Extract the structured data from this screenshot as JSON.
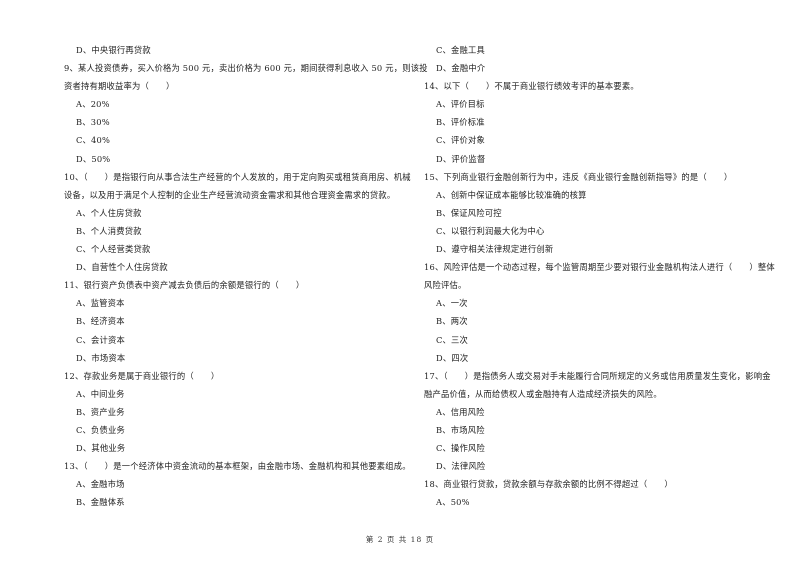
{
  "left_column": [
    {
      "type": "opt",
      "text": "D、中央银行再贷款"
    },
    {
      "type": "q",
      "text": "9、某人投资债券，买入价格为 500 元，卖出价格为 600 元，期间获得利息收入 50 元，则该投"
    },
    {
      "type": "q",
      "text": "资者持有期收益率为（　　）"
    },
    {
      "type": "opt",
      "text": "A、20%"
    },
    {
      "type": "opt",
      "text": "B、30%"
    },
    {
      "type": "opt",
      "text": "C、40%"
    },
    {
      "type": "opt",
      "text": "D、50%"
    },
    {
      "type": "q",
      "text": "10、（　　）是指银行向从事合法生产经营的个人发放的，用于定向购买或租赁商用房、机械"
    },
    {
      "type": "q",
      "text": "设备，以及用于满足个人控制的企业生产经营流动资金需求和其他合理资金需求的贷款。"
    },
    {
      "type": "opt",
      "text": "A、个人住房贷款"
    },
    {
      "type": "opt",
      "text": "B、个人消费贷款"
    },
    {
      "type": "opt",
      "text": "C、个人经营类贷款"
    },
    {
      "type": "opt",
      "text": "D、自营性个人住房贷款"
    },
    {
      "type": "q",
      "text": "11、银行资产负债表中资产减去负债后的余额是银行的（　　）"
    },
    {
      "type": "opt",
      "text": "A、监管资本"
    },
    {
      "type": "opt",
      "text": "B、经济资本"
    },
    {
      "type": "opt",
      "text": "C、会计资本"
    },
    {
      "type": "opt",
      "text": "D、市场资本"
    },
    {
      "type": "q",
      "text": "12、存款业务是属于商业银行的（　　）"
    },
    {
      "type": "opt",
      "text": "A、中间业务"
    },
    {
      "type": "opt",
      "text": "B、资产业务"
    },
    {
      "type": "opt",
      "text": "C、负债业务"
    },
    {
      "type": "opt",
      "text": "D、其他业务"
    },
    {
      "type": "q",
      "text": "13、（　　）是一个经济体中资金流动的基本框架，由金融市场、金融机构和其他要素组成。"
    },
    {
      "type": "opt",
      "text": "A、金融市场"
    },
    {
      "type": "opt",
      "text": "B、金融体系"
    }
  ],
  "right_column": [
    {
      "type": "opt",
      "text": "C、金融工具"
    },
    {
      "type": "opt",
      "text": "D、金融中介"
    },
    {
      "type": "q",
      "text": "14、以下（　　）不属于商业银行绩效考评的基本要素。"
    },
    {
      "type": "opt",
      "text": "A、评价目标"
    },
    {
      "type": "opt",
      "text": "B、评价标准"
    },
    {
      "type": "opt",
      "text": "C、评价对象"
    },
    {
      "type": "opt",
      "text": "D、评价监督"
    },
    {
      "type": "q",
      "text": "15、下列商业银行金融创新行为中，违反《商业银行金融创新指导》的是（　　）"
    },
    {
      "type": "opt",
      "text": "A、创新中保证成本能够比较准确的核算"
    },
    {
      "type": "opt",
      "text": "B、保证风险可控"
    },
    {
      "type": "opt",
      "text": "C、以银行利润最大化为中心"
    },
    {
      "type": "opt",
      "text": "D、遵守相关法律规定进行创新"
    },
    {
      "type": "q",
      "text": "16、风险评估是一个动态过程，每个监管周期至少要对银行业金融机构法人进行（　　）整体"
    },
    {
      "type": "q",
      "text": "风险评估。"
    },
    {
      "type": "opt",
      "text": "A、一次"
    },
    {
      "type": "opt",
      "text": "B、两次"
    },
    {
      "type": "opt",
      "text": "C、三次"
    },
    {
      "type": "opt",
      "text": "D、四次"
    },
    {
      "type": "q",
      "text": "17、（　　）是指债务人或交易对手未能履行合同所规定的义务或信用质量发生变化，影响金"
    },
    {
      "type": "q",
      "text": "融产品价值，从而给债权人或金融持有人造成经济损失的风险。"
    },
    {
      "type": "opt",
      "text": "A、信用风险"
    },
    {
      "type": "opt",
      "text": "B、市场风险"
    },
    {
      "type": "opt",
      "text": "C、操作风险"
    },
    {
      "type": "opt",
      "text": "D、法律风险"
    },
    {
      "type": "q",
      "text": "18、商业银行贷款，贷款余额与存款余额的比例不得超过（　　）"
    },
    {
      "type": "opt",
      "text": "A、50%"
    }
  ],
  "footer": {
    "page_label": "第 2 页 共 18 页"
  }
}
